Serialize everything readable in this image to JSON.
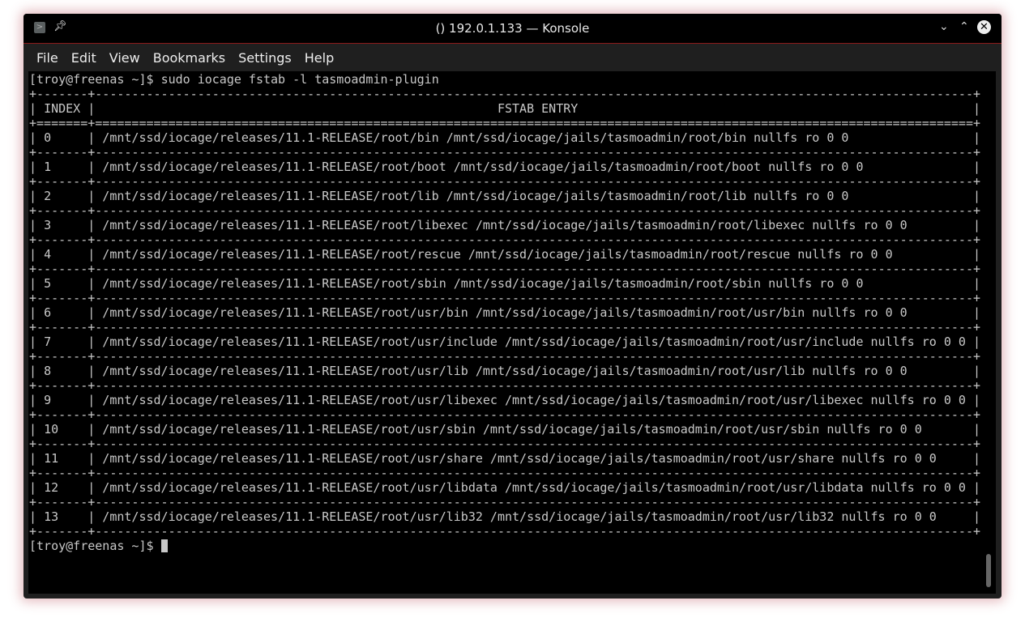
{
  "window": {
    "title": "() 192.0.1.133 — Konsole"
  },
  "menu": [
    "File",
    "Edit",
    "View",
    "Bookmarks",
    "Settings",
    "Help"
  ],
  "terminal": {
    "prompt": "[troy@freenas ~]$ ",
    "command": "sudo iocage fstab -l tasmoadmin-plugin",
    "headers": {
      "index": "INDEX",
      "entry": "FSTAB ENTRY"
    },
    "rows": [
      {
        "index": "0",
        "entry": "/mnt/ssd/iocage/releases/11.1-RELEASE/root/bin /mnt/ssd/iocage/jails/tasmoadmin/root/bin nullfs ro 0 0"
      },
      {
        "index": "1",
        "entry": "/mnt/ssd/iocage/releases/11.1-RELEASE/root/boot /mnt/ssd/iocage/jails/tasmoadmin/root/boot nullfs ro 0 0"
      },
      {
        "index": "2",
        "entry": "/mnt/ssd/iocage/releases/11.1-RELEASE/root/lib /mnt/ssd/iocage/jails/tasmoadmin/root/lib nullfs ro 0 0"
      },
      {
        "index": "3",
        "entry": "/mnt/ssd/iocage/releases/11.1-RELEASE/root/libexec /mnt/ssd/iocage/jails/tasmoadmin/root/libexec nullfs ro 0 0"
      },
      {
        "index": "4",
        "entry": "/mnt/ssd/iocage/releases/11.1-RELEASE/root/rescue /mnt/ssd/iocage/jails/tasmoadmin/root/rescue nullfs ro 0 0"
      },
      {
        "index": "5",
        "entry": "/mnt/ssd/iocage/releases/11.1-RELEASE/root/sbin /mnt/ssd/iocage/jails/tasmoadmin/root/sbin nullfs ro 0 0"
      },
      {
        "index": "6",
        "entry": "/mnt/ssd/iocage/releases/11.1-RELEASE/root/usr/bin /mnt/ssd/iocage/jails/tasmoadmin/root/usr/bin nullfs ro 0 0"
      },
      {
        "index": "7",
        "entry": "/mnt/ssd/iocage/releases/11.1-RELEASE/root/usr/include /mnt/ssd/iocage/jails/tasmoadmin/root/usr/include nullfs ro 0 0"
      },
      {
        "index": "8",
        "entry": "/mnt/ssd/iocage/releases/11.1-RELEASE/root/usr/lib /mnt/ssd/iocage/jails/tasmoadmin/root/usr/lib nullfs ro 0 0"
      },
      {
        "index": "9",
        "entry": "/mnt/ssd/iocage/releases/11.1-RELEASE/root/usr/libexec /mnt/ssd/iocage/jails/tasmoadmin/root/usr/libexec nullfs ro 0 0"
      },
      {
        "index": "10",
        "entry": "/mnt/ssd/iocage/releases/11.1-RELEASE/root/usr/sbin /mnt/ssd/iocage/jails/tasmoadmin/root/usr/sbin nullfs ro 0 0"
      },
      {
        "index": "11",
        "entry": "/mnt/ssd/iocage/releases/11.1-RELEASE/root/usr/share /mnt/ssd/iocage/jails/tasmoadmin/root/usr/share nullfs ro 0 0"
      },
      {
        "index": "12",
        "entry": "/mnt/ssd/iocage/releases/11.1-RELEASE/root/usr/libdata /mnt/ssd/iocage/jails/tasmoadmin/root/usr/libdata nullfs ro 0 0"
      },
      {
        "index": "13",
        "entry": "/mnt/ssd/iocage/releases/11.1-RELEASE/root/usr/lib32 /mnt/ssd/iocage/jails/tasmoadmin/root/usr/lib32 nullfs ro 0 0"
      }
    ]
  }
}
